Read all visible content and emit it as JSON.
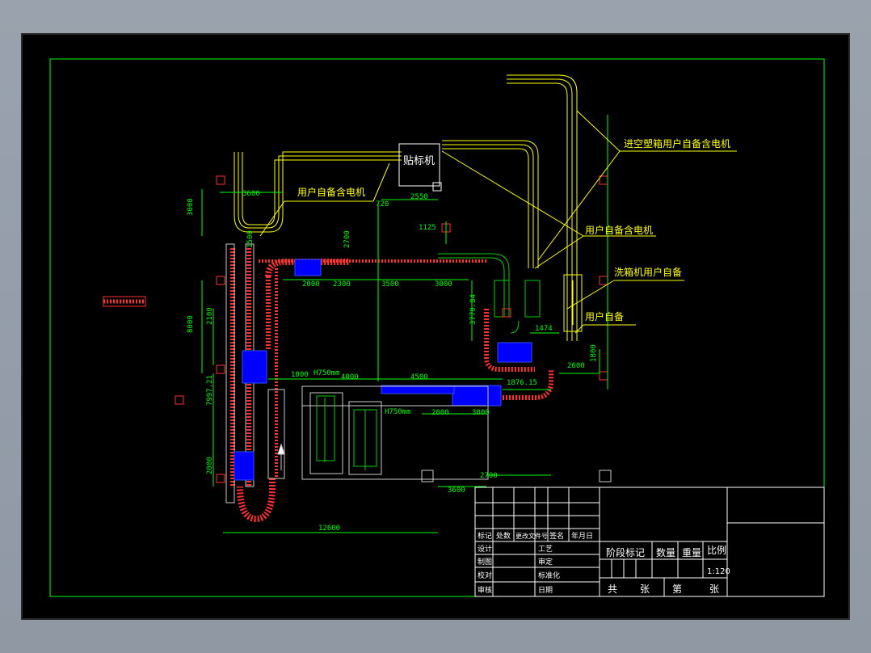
{
  "colors": {
    "background": "#000000",
    "border": "#00ff00",
    "conveyor_red": "#ff3030",
    "conveyor_yellow": "#ffff00",
    "conveyor_green": "#00d000",
    "dimension": "#00ff00",
    "blue_block": "#0000ff",
    "leader": "#ffff00",
    "white": "#ffffff"
  },
  "annotations": {
    "labeler": "贴标机",
    "user_motor_1": "用户自备含电机",
    "user_motor_2": "用户自备含电机",
    "plastic_box_motor": "进空塑箱用户自备含电机",
    "box_washer": "洗箱机用户自备",
    "user_supplied": "用户自备"
  },
  "dimensions": {
    "d3600_top": "3600",
    "d3000": "3000",
    "d720": "720",
    "d2550": "2550",
    "d2000_a": "2000",
    "d2300": "2300",
    "d3500": "3500",
    "d3000_b": "3000",
    "d2700": "2700",
    "d1125": "1125",
    "d1500": "1500",
    "d2100": "2100",
    "d8000": "8000",
    "d7997": "7997.21",
    "d2000_left": "2000",
    "d1000": "1000",
    "d4000": "4000",
    "d4500": "4500",
    "d2000_b": "2000",
    "d3000_c": "3000",
    "d3770": "3770.84",
    "d1474": "1474",
    "d1800": "1800",
    "d2600": "2600",
    "d1876": "1876.15",
    "d2700_b": "2700",
    "d3600_b": "3600",
    "d12600": "12600",
    "h750_a": "H750mm",
    "h750_b": "H750mm"
  },
  "title_block": {
    "mark": "标记",
    "count": "处数",
    "change_doc": "更改文件号",
    "sign": "签名",
    "date": "年月日",
    "design": "设计",
    "process": "工艺",
    "drawing": "制图",
    "review": "审定",
    "check": "校对",
    "standard": "标准化",
    "approve": "审核",
    "approve_date": "日期",
    "stage_mark": "阶段标记",
    "quantity": "数量",
    "weight": "重量",
    "scale": "比例",
    "scale_value": "1:120",
    "total": "共",
    "sheets": "张",
    "sheet_no": "第",
    "sheets2": "张"
  }
}
